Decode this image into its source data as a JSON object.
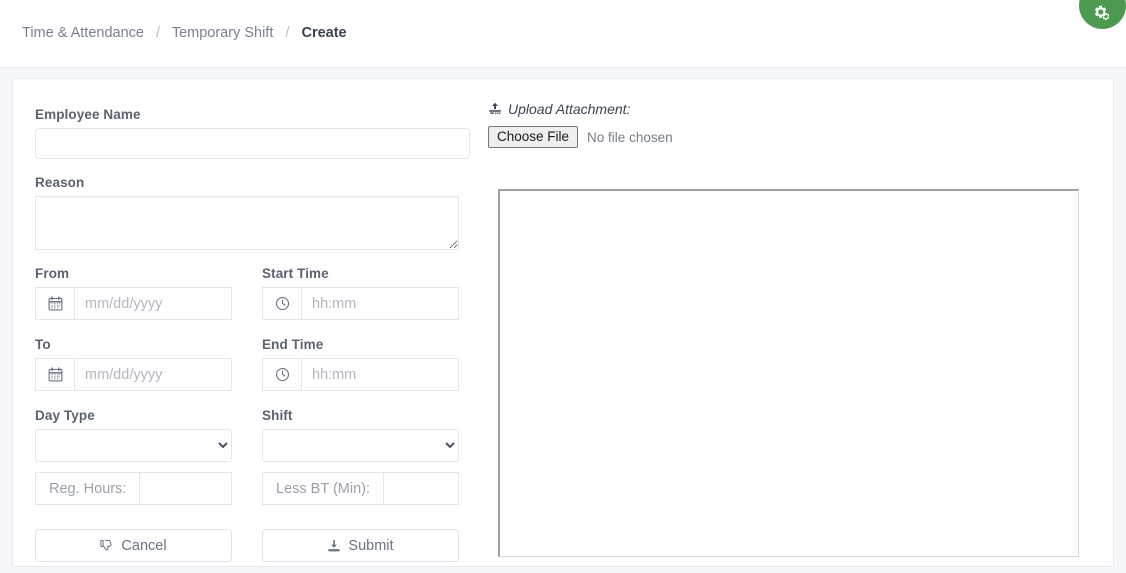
{
  "breadcrumb": {
    "items": [
      {
        "label": "Time & Attendance",
        "active": false
      },
      {
        "label": "Temporary Shift",
        "active": false
      },
      {
        "label": "Create",
        "active": true
      }
    ],
    "separator": "/"
  },
  "fab": {
    "icon": "cogs-icon",
    "color": "#4c9a4f"
  },
  "form": {
    "employee_name": {
      "label": "Employee Name",
      "value": "",
      "placeholder": ""
    },
    "reason": {
      "label": "Reason",
      "value": "",
      "placeholder": ""
    },
    "from": {
      "label": "From",
      "value": "",
      "placeholder": "mm/dd/yyyy",
      "icon": "calendar-icon"
    },
    "start_time": {
      "label": "Start Time",
      "value": "",
      "placeholder": "hh:mm",
      "icon": "clock-icon"
    },
    "to": {
      "label": "To",
      "value": "",
      "placeholder": "mm/dd/yyyy",
      "icon": "calendar-icon"
    },
    "end_time": {
      "label": "End Time",
      "value": "",
      "placeholder": "hh:mm",
      "icon": "clock-icon"
    },
    "day_type": {
      "label": "Day Type",
      "selected": "",
      "options": [
        ""
      ]
    },
    "shift": {
      "label": "Shift",
      "selected": "",
      "options": [
        ""
      ]
    },
    "reg_hours": {
      "prefix": "Reg. Hours:",
      "value": "",
      "placeholder": ""
    },
    "less_bt": {
      "prefix": "Less BT (Min):",
      "value": "",
      "placeholder": ""
    },
    "cancel_button": {
      "label": "Cancel",
      "icon": "thumbs-down-icon"
    },
    "submit_button": {
      "label": "Submit",
      "icon": "download-save-icon"
    }
  },
  "upload": {
    "label": "Upload Attachment:",
    "icon": "upload-icon",
    "choose_file_label": "Choose File",
    "file_status": "No file chosen"
  },
  "colors": {
    "page_background": "#f4f6f9",
    "card_background": "#ffffff",
    "accent_green": "#4c9a4f",
    "label_text": "#5b6270",
    "muted_text": "#7b8190",
    "border": "#e3e6ea"
  }
}
